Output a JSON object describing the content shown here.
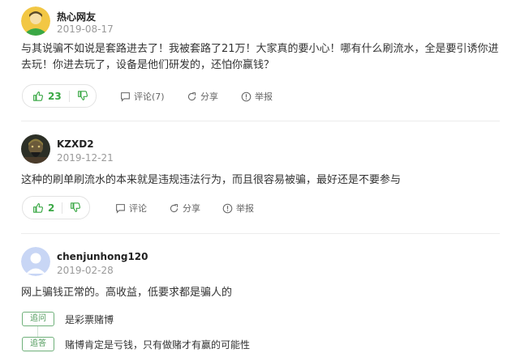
{
  "posts": [
    {
      "user": "热心网友",
      "date": "2019-08-17",
      "content": "与其说骗不如说是套路进去了！我被套路了21万！大家真的要小心！哪有什么刷流水，全是要引诱你进去玩！你进去玩了，设备是他们研发的，还怕你赢钱？",
      "votes": "23",
      "comment_label": "评论(7)",
      "share_label": "分享",
      "report_label": "举报"
    },
    {
      "user": "KZXD2",
      "date": "2019-12-21",
      "content": "这种的刷单刷流水的本来就是违规违法行为，而且很容易被骗，最好还是不要参与",
      "votes": "2",
      "comment_label": "评论",
      "share_label": "分享",
      "report_label": "举报"
    },
    {
      "user": "chenjunhong120",
      "date": "2019-02-28",
      "content": "网上骗钱正常的。高收益，低要求都是骗人的",
      "qa": [
        {
          "tag": "追问",
          "text": "是彩票赌博"
        },
        {
          "tag": "追答",
          "text": "赌博肯定是亏钱，只有做赌才有赢的可能性"
        }
      ]
    }
  ],
  "colors": {
    "accent": "#3aa845",
    "avatar_default": "#c8d6f5",
    "avatar_yellow": "#f2c744"
  },
  "icons": [
    "avatar-default-yellow",
    "avatar-photo",
    "avatar-default-blue",
    "thumb-up-icon",
    "thumb-down-icon",
    "comment-icon",
    "share-icon",
    "report-icon"
  ]
}
